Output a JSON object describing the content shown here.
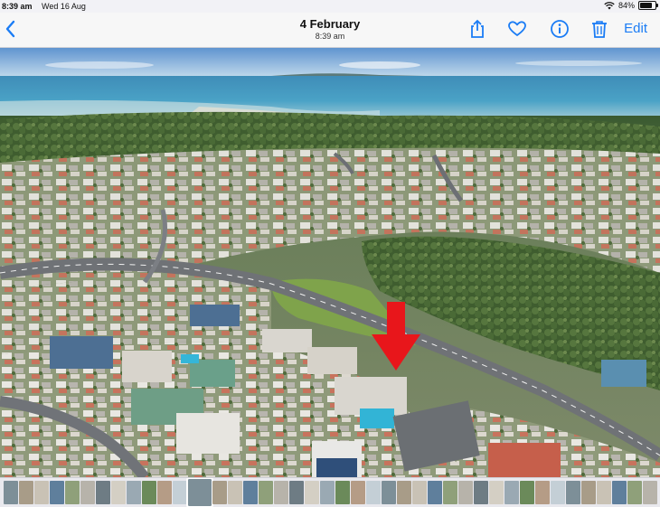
{
  "status_bar": {
    "time": "8:39 am",
    "date": "Wed 16 Aug",
    "battery": "84%",
    "battery_level": 0.84,
    "wifi_icon": "wifi-icon"
  },
  "header": {
    "title": "4 February",
    "subtitle": "8:39 am",
    "edit_label": "Edit",
    "back_icon": "chevron-left-icon",
    "actions": [
      "share-icon",
      "heart-icon",
      "info-icon",
      "trash-icon"
    ],
    "accent_color": "#1a7cf5"
  },
  "photo": {
    "annotation_icon": "red-arrow-icon",
    "annotation_color": "#e8161b"
  },
  "thumbnails": {
    "count": 44,
    "current_index": 12
  }
}
